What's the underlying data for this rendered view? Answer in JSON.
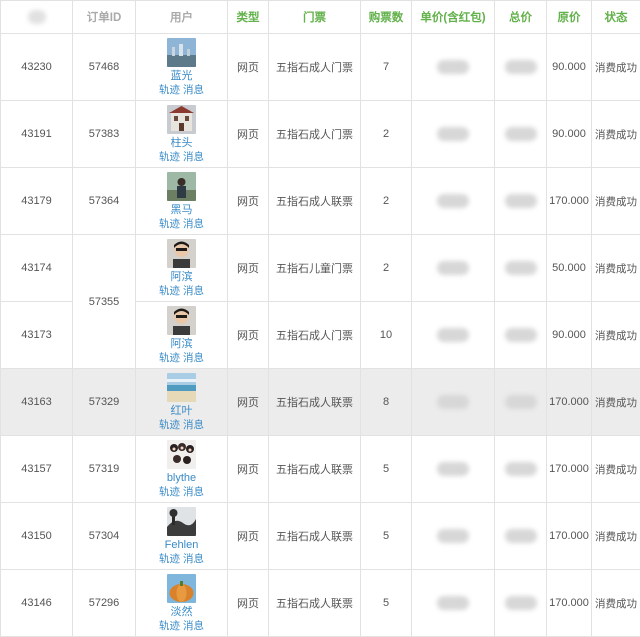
{
  "headers": {
    "id": "ID",
    "order_id": "订单ID",
    "user": "用户",
    "type": "类型",
    "ticket": "门票",
    "qty": "购票数",
    "unit_price": "单价(含红包)",
    "total": "总价",
    "orig_price": "原价",
    "status": "状态"
  },
  "link_labels": {
    "track": "轨迹",
    "message": "消息"
  },
  "colors": {
    "header_green": "#62b14a",
    "link_blue": "#3a8bc7",
    "row_highlight": "#ececec"
  },
  "rows": [
    {
      "id": "43230",
      "order": "57468",
      "user": "蓝光",
      "avatar": "sky-avatar",
      "type": "网页",
      "ticket": "五指石成人门票",
      "qty": "7",
      "orig": "90.000",
      "status": "消费成功"
    },
    {
      "id": "43191",
      "order": "57383",
      "user": "柱头",
      "avatar": "building-avatar",
      "type": "网页",
      "ticket": "五指石成人门票",
      "qty": "2",
      "orig": "90.000",
      "status": "消费成功"
    },
    {
      "id": "43179",
      "order": "57364",
      "user": "黑马",
      "avatar": "person-avatar",
      "type": "网页",
      "ticket": "五指石成人联票",
      "qty": "2",
      "orig": "170.000",
      "status": "消费成功"
    },
    {
      "id": "43174",
      "order": "57355",
      "user": "阿滨",
      "avatar": "portrait-avatar",
      "type": "网页",
      "ticket": "五指石儿童门票",
      "qty": "2",
      "orig": "50.000",
      "status": "消费成功"
    },
    {
      "id": "43173",
      "order": "57355",
      "user": "阿滨",
      "avatar": "portrait-avatar",
      "type": "网页",
      "ticket": "五指石成人门票",
      "qty": "10",
      "orig": "90.000",
      "status": "消费成功"
    },
    {
      "id": "43163",
      "order": "57329",
      "user": "红叶",
      "avatar": "beach-avatar",
      "type": "网页",
      "ticket": "五指石成人联票",
      "qty": "8",
      "orig": "170.000",
      "status": "消费成功"
    },
    {
      "id": "43157",
      "order": "57319",
      "user": "blythe",
      "avatar": "doll-avatar",
      "type": "网页",
      "ticket": "五指石成人联票",
      "qty": "5",
      "orig": "170.000",
      "status": "消费成功"
    },
    {
      "id": "43150",
      "order": "57304",
      "user": "Fehlen",
      "avatar": "landscape-avatar",
      "type": "网页",
      "ticket": "五指石成人联票",
      "qty": "5",
      "orig": "170.000",
      "status": "消费成功"
    },
    {
      "id": "43146",
      "order": "57296",
      "user": "淡然",
      "avatar": "pumpkin-avatar",
      "type": "网页",
      "ticket": "五指石成人联票",
      "qty": "5",
      "orig": "170.000",
      "status": "消费成功"
    }
  ]
}
